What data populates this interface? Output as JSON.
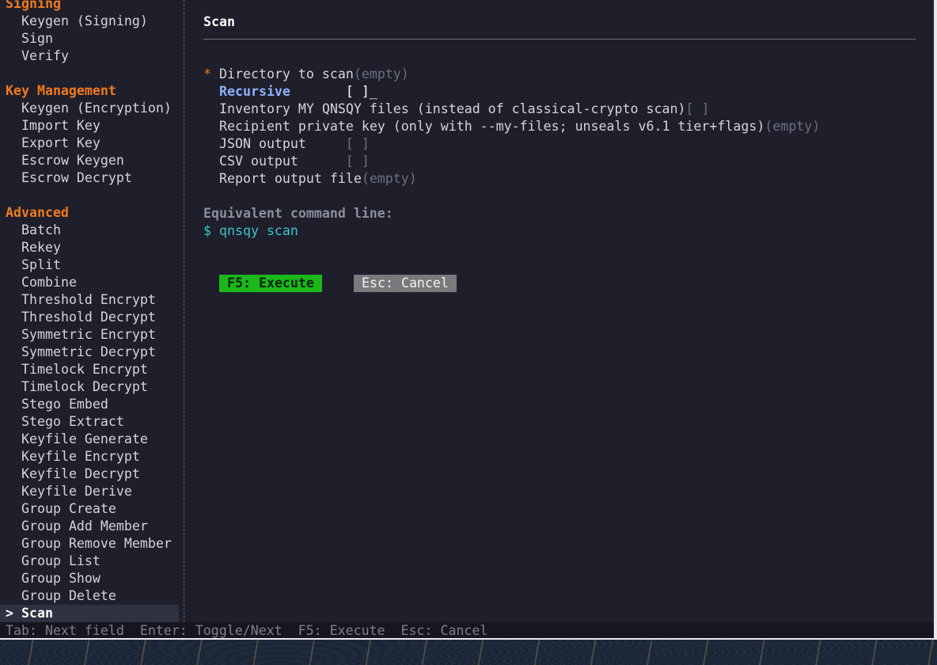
{
  "sidebar": {
    "signing": {
      "label": "Signing",
      "items": [
        "Keygen (Signing)",
        "Sign",
        "Verify"
      ]
    },
    "key_management": {
      "label": "Key Management",
      "items": [
        "Keygen (Encryption)",
        "Import Key",
        "Export Key",
        "Escrow Keygen",
        "Escrow Decrypt"
      ]
    },
    "advanced": {
      "label": "Advanced",
      "items": [
        "Batch",
        "Rekey",
        "Split",
        "Combine",
        "Threshold Encrypt",
        "Threshold Decrypt",
        "Symmetric Encrypt",
        "Symmetric Decrypt",
        "Timelock Encrypt",
        "Timelock Decrypt",
        "Stego Embed",
        "Stego Extract",
        "Keyfile Generate",
        "Keyfile Encrypt",
        "Keyfile Decrypt",
        "Keyfile Derive",
        "Group Create",
        "Group Add Member",
        "Group Remove Member",
        "Group List",
        "Group Show",
        "Group Delete"
      ]
    },
    "selected": {
      "marker": ">",
      "label": "Scan"
    }
  },
  "main": {
    "title": "Scan",
    "fields": {
      "directory": {
        "required_mark": "*",
        "label": "Directory to scan",
        "value": "(empty)"
      },
      "recursive": {
        "label": "Recursive",
        "value": "[ ]",
        "cursor": "_"
      },
      "inventory": {
        "label": "Inventory MY QNSQY files (instead of classical-crypto scan)",
        "value": "[ ]"
      },
      "recipient_key": {
        "label": "Recipient private key (only with --my-files; unseals v6.1 tier+flags)",
        "value": "(empty)"
      },
      "json_output": {
        "label": "JSON output",
        "value": "[ ]"
      },
      "csv_output": {
        "label": "CSV output",
        "value": "[ ]"
      },
      "report_file": {
        "label": "Report output file",
        "value": "(empty)"
      }
    },
    "command_line_label": "Equivalent command line:",
    "command_line": "$ qnsqy scan",
    "buttons": {
      "execute": "F5: Execute",
      "cancel": "Esc: Cancel"
    }
  },
  "statusbar": {
    "text": "Tab: Next field  Enter: Toggle/Next  F5: Execute  Esc: Cancel"
  },
  "colors": {
    "category": "#f07a1e",
    "focus": "#8fb0ff",
    "command": "#3cc3c9",
    "execute_bg": "#1bb81b",
    "cancel_bg": "#7a7a7e",
    "background": "#1e1f2b"
  }
}
